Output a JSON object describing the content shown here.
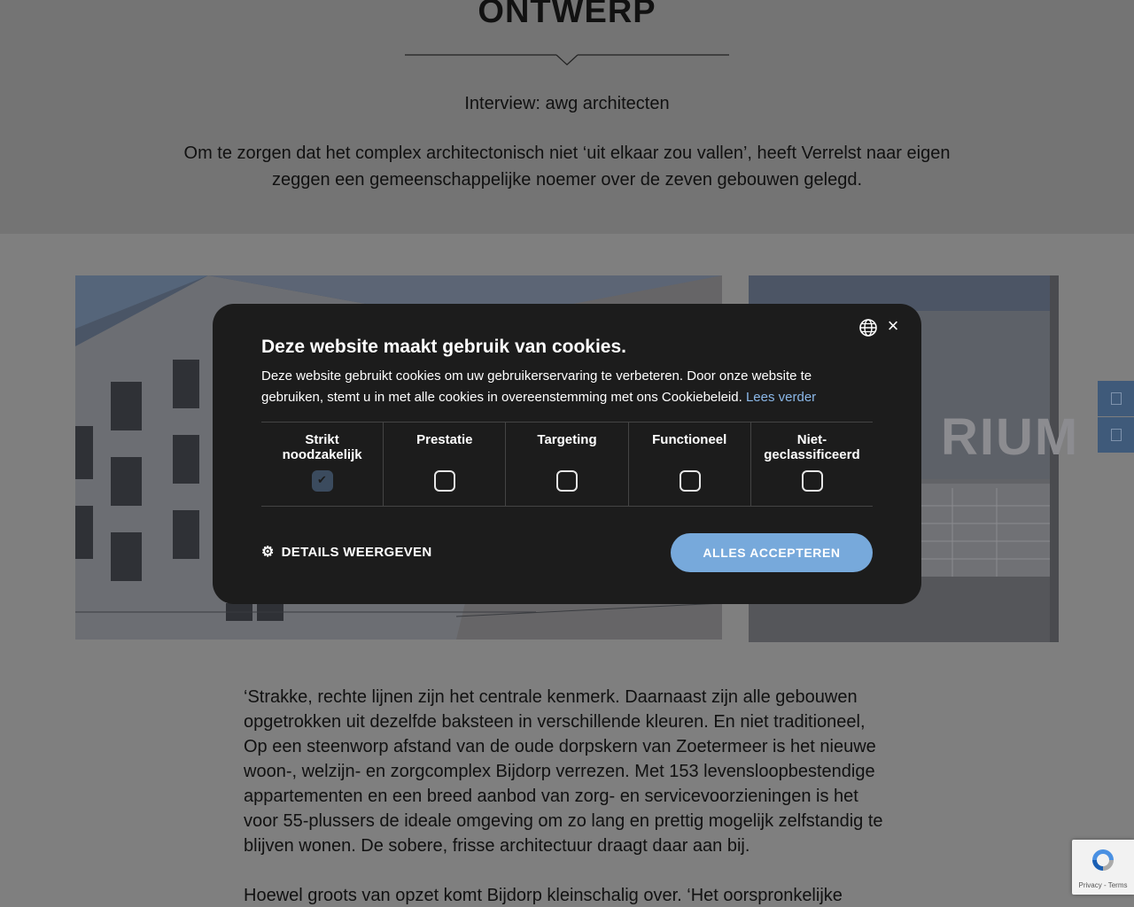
{
  "hero": {
    "title": "ONTWERP",
    "subtitle": "Interview: awg architecten",
    "intro": "Om te zorgen dat het complex architectonisch niet ‘uit elkaar zou vallen’, heeft Verrelst naar eigen zeggen een gemeenschappelijke noemer over de zeven gebouwen gelegd."
  },
  "article": {
    "paragraph_1": "‘Strakke, rechte lijnen zijn het centrale kenmerk. Daarnaast zijn alle gebouwen opgetrokken uit dezelfde baksteen in verschillende kleuren. En niet traditioneel, Op een steenworp afstand van de oude dorpskern van Zoetermeer is het nieuwe woon-, welzijn- en zorgcomplex Bijdorp verrezen. Met 153 levensloopbestendige appartementen en een breed aanbod van zorg- en servicevoorzieningen is het voor 55-plussers de ideale omgeving om zo lang en prettig mogelijk zelfstandig te blijven wonen. De sobere, frisse architectuur draagt daar aan bij.",
    "paragraph_2": "Hoewel groots van opzet komt Bijdorp kleinschalig over. ‘Het oorspronkelijke"
  },
  "photos": {
    "right_sign_text": "RIUM"
  },
  "cookie": {
    "title": "Deze website maakt gebruik van cookies.",
    "text": "Deze website gebruikt cookies om uw gebruikerservaring te verbeteren. Door onze website te gebruiken, stemt u in met alle cookies in overeenstemming met ons Cookiebeleid.",
    "link": "Lees verder",
    "close_glyph": "×",
    "categories": [
      {
        "label": "Strikt noodzakelijk",
        "checked": true
      },
      {
        "label": "Prestatie",
        "checked": false
      },
      {
        "label": "Targeting",
        "checked": false
      },
      {
        "label": "Functioneel",
        "checked": false
      },
      {
        "label": "Niet-geclassificeerd",
        "checked": false
      }
    ],
    "details_label": "DETAILS WEERGEVEN",
    "accept_label": "ALLES ACCEPTEREN",
    "accept_color": "#77a9db"
  },
  "recaptcha": {
    "links": "Privacy - Terms"
  },
  "icons": {
    "language": "globe-icon",
    "close": "close-icon",
    "details": "gear-icon",
    "checkbox": "check-icon"
  }
}
